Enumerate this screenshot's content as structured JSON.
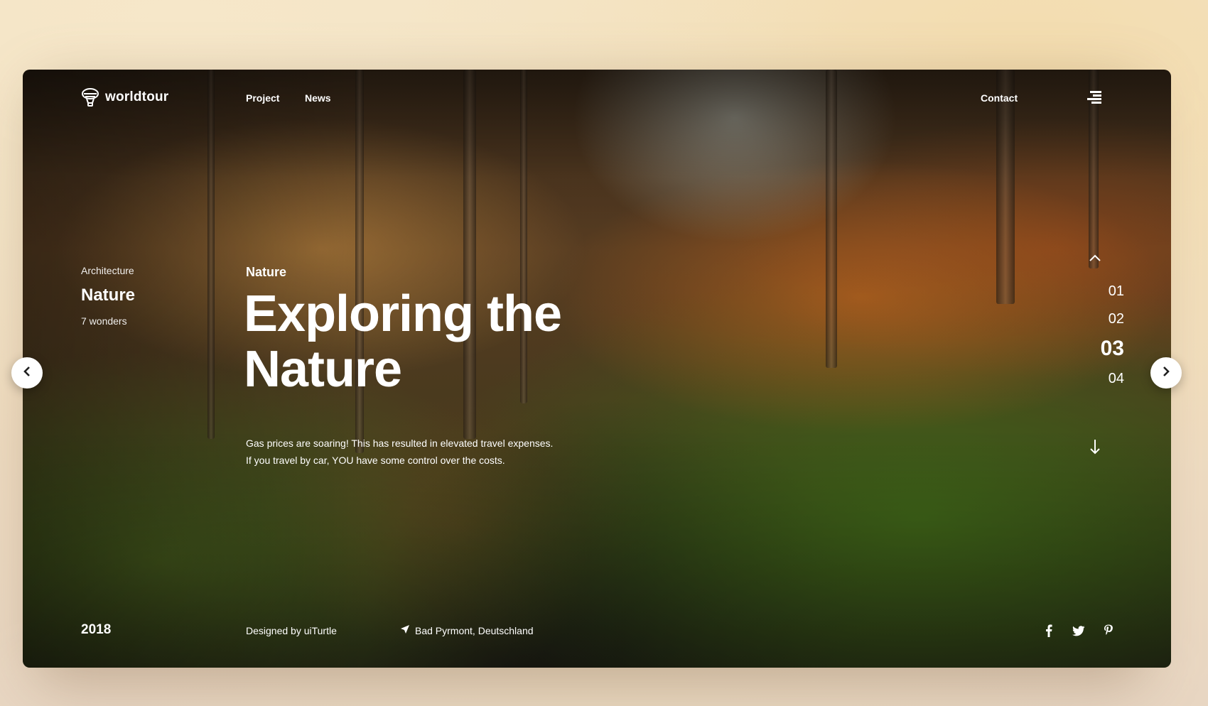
{
  "brand": {
    "name": "worldtour",
    "icon": "balloon-icon"
  },
  "nav": {
    "project": "Project",
    "news": "News",
    "contact": "Contact"
  },
  "side": {
    "category": "Architecture",
    "title": "Nature",
    "subtitle": "7 wonders"
  },
  "hero": {
    "kicker": "Nature",
    "title_line1": "Exploring the",
    "title_line2": "Nature",
    "desc_line1": "Gas prices are soaring! This has resulted in elevated travel expenses.",
    "desc_line2": "If you travel by car, YOU have some control over the costs."
  },
  "pager": {
    "items": [
      "01",
      "02",
      "03",
      "04"
    ],
    "active_index": 2
  },
  "footer": {
    "year": "2018",
    "designed": "Designed by uiTurtle",
    "location": "Bad Pyrmont, Deutschland"
  },
  "socials": [
    "facebook-icon",
    "twitter-icon",
    "pinterest-icon"
  ],
  "colors": {
    "text": "#ffffff",
    "button_bg": "#ffffff",
    "button_icon": "#1f1f1f"
  }
}
